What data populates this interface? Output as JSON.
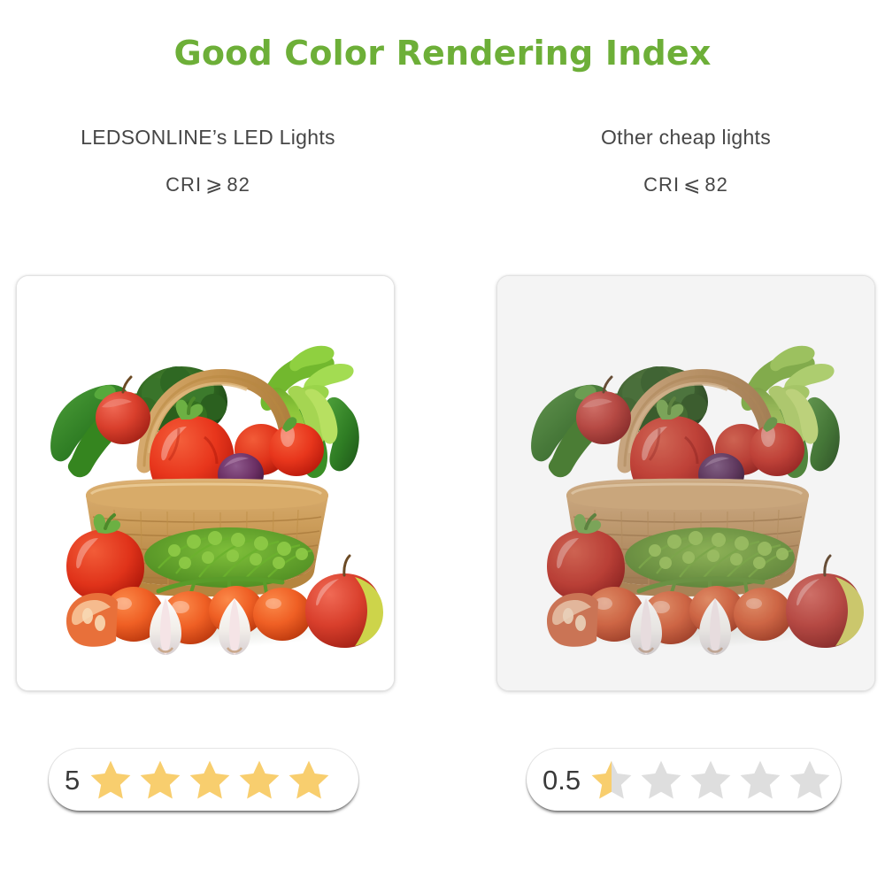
{
  "header": {
    "title": "Good Color Rendering Index",
    "title_color": "#6DAF38"
  },
  "columns": [
    {
      "id": "ledsonline",
      "name": "LEDSONLINE’s LED Lights",
      "cri_label": "CRI",
      "cri_symbol": "⩾",
      "cri_value": "82",
      "image_alt": "Wicker basket filled with fresh vegetables — vivid colors",
      "rating": {
        "score": "5",
        "stars_total": 5,
        "stars_filled": 5,
        "star_color": "#F8CE6E",
        "star_empty_color": "#DEDEDE"
      }
    },
    {
      "id": "other",
      "name": "Other cheap lights",
      "cri_label": "CRI",
      "cri_symbol": "⩽",
      "cri_value": "82",
      "image_alt": "Wicker basket filled with fresh vegetables — dull, washed-out colors",
      "rating": {
        "score": "0.5",
        "stars_total": 5,
        "stars_filled": 0.5,
        "star_color": "#F8CE6E",
        "star_empty_color": "#DEDEDE"
      }
    }
  ],
  "icons": {
    "star": "star-icon",
    "star_half": "star-half-icon",
    "star_empty": "star-empty-icon"
  },
  "theme": {
    "background": "#FFFFFF",
    "text_primary": "#464646",
    "frame_border": "#E2E2E2"
  }
}
